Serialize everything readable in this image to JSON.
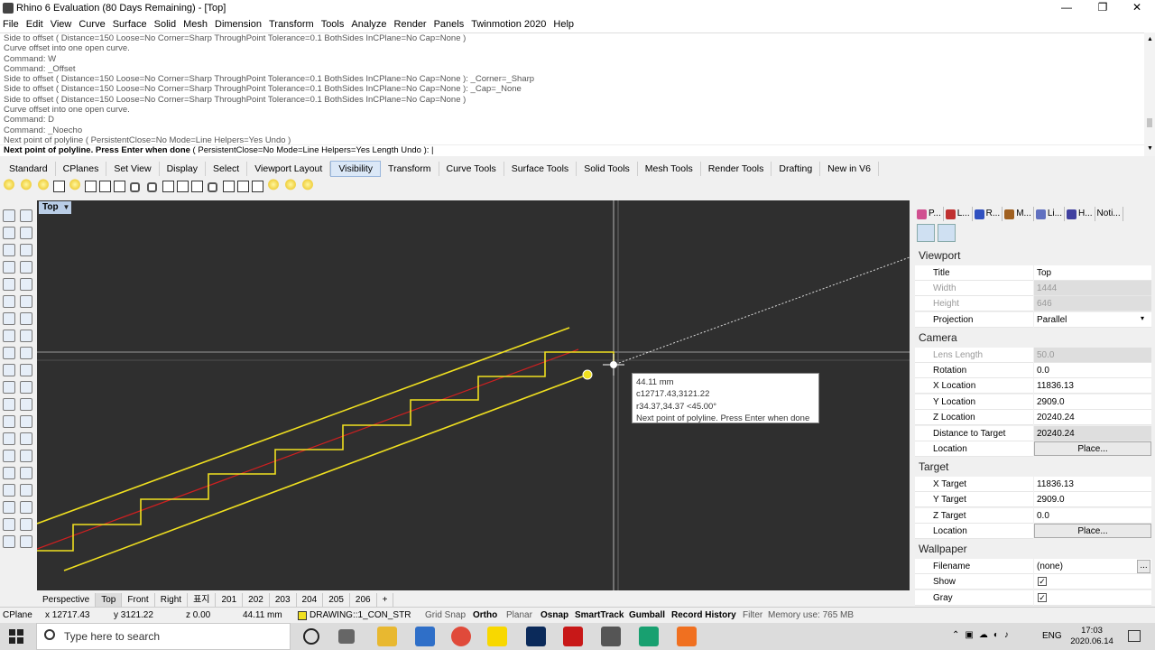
{
  "window": {
    "title": "Rhino 6 Evaluation (80 Days Remaining) - [Top]",
    "minimize": "—",
    "maximize": "❐",
    "close": "✕"
  },
  "menu": [
    "File",
    "Edit",
    "View",
    "Curve",
    "Surface",
    "Solid",
    "Mesh",
    "Dimension",
    "Transform",
    "Tools",
    "Analyze",
    "Render",
    "Panels",
    "Twinmotion 2020",
    "Help"
  ],
  "command_history": [
    "Side to offset ( Distance=150  Loose=No  Corner=Sharp  ThroughPoint  Tolerance=0.1  BothSides  InCPlane=No  Cap=None )",
    "Curve offset into one open curve.",
    "Command: W",
    "Command: _Offset",
    "Side to offset ( Distance=150  Loose=No  Corner=Sharp  ThroughPoint  Tolerance=0.1  BothSides  InCPlane=No  Cap=None ): _Corner=_Sharp",
    "Side to offset ( Distance=150  Loose=No  Corner=Sharp  ThroughPoint  Tolerance=0.1  BothSides  InCPlane=No  Cap=None ): _Cap=_None",
    "Side to offset ( Distance=150  Loose=No  Corner=Sharp  ThroughPoint  Tolerance=0.1  BothSides  InCPlane=No  Cap=None )",
    "Curve offset into one open curve.",
    "Command: D",
    "Command: _Noecho",
    "Next point of polyline ( PersistentClose=No  Mode=Line  Helpers=Yes  Undo )"
  ],
  "command_prompt": {
    "bold": "Next point of polyline. Press Enter when done",
    "rest": " ( PersistentClose=No  Mode=Line  Helpers=Yes  Length  Undo ): |"
  },
  "toolbar_tabs": [
    "Standard",
    "CPlanes",
    "Set View",
    "Display",
    "Select",
    "Viewport Layout",
    "Visibility",
    "Transform",
    "Curve Tools",
    "Surface Tools",
    "Solid Tools",
    "Mesh Tools",
    "Render Tools",
    "Drafting",
    "New in V6"
  ],
  "active_toolbar_tab": "Visibility",
  "viewport": {
    "name": "Top",
    "tooltip": {
      "distance": "44.11 mm",
      "coords": "c12717.43,3121.22",
      "polar": "r34.37,34.37     <45.00°",
      "message": "Next point of polyline. Press Enter when done"
    }
  },
  "panel_tabs": [
    "P...",
    "L...",
    "R...",
    "M...",
    "Li...",
    "H...",
    "Noti..."
  ],
  "properties": {
    "viewport_header": "Viewport",
    "viewport": [
      {
        "label": "Title",
        "value": "Top",
        "disabled": false
      },
      {
        "label": "Width",
        "value": "1444",
        "disabled": true
      },
      {
        "label": "Height",
        "value": "646",
        "disabled": true
      },
      {
        "label": "Projection",
        "value": "Parallel",
        "disabled": false
      }
    ],
    "camera_header": "Camera",
    "camera": [
      {
        "label": "Lens Length",
        "value": "50.0",
        "disabled": true
      },
      {
        "label": "Rotation",
        "value": "0.0",
        "disabled": false
      },
      {
        "label": "X Location",
        "value": "11836.13",
        "disabled": false
      },
      {
        "label": "Y Location",
        "value": "2909.0",
        "disabled": false
      },
      {
        "label": "Z Location",
        "value": "20240.24",
        "disabled": false
      },
      {
        "label": "Distance to Target",
        "value": "20240.24",
        "disabled": false
      }
    ],
    "camera_location_label": "Location",
    "place_button": "Place...",
    "target_header": "Target",
    "target": [
      {
        "label": "X Target",
        "value": "11836.13"
      },
      {
        "label": "Y Target",
        "value": "2909.0"
      },
      {
        "label": "Z Target",
        "value": "0.0"
      }
    ],
    "target_location_label": "Location",
    "wallpaper_header": "Wallpaper",
    "filename_label": "Filename",
    "filename_value": "(none)",
    "filename_browse": "...",
    "show_label": "Show",
    "gray_label": "Gray",
    "check": "✓"
  },
  "viewport_tabs": [
    "Perspective",
    "Top",
    "Front",
    "Right",
    "표지",
    "201",
    "202",
    "203",
    "204",
    "205",
    "206",
    "+"
  ],
  "active_viewport_tab": "Top",
  "status": {
    "cplane": "CPlane",
    "x": "x 12717.43",
    "y": "y 3121.22",
    "z": "z 0.00",
    "units": "44.11 mm",
    "layer": "DRAWING::1_CON_STR",
    "layer_color": "#f0e020",
    "grid_snap": "Grid Snap",
    "ortho": "Ortho",
    "planar": "Planar",
    "osnap": "Osnap",
    "smarttrack": "SmartTrack",
    "gumball": "Gumball",
    "record_history": "Record History",
    "filter": "Filter",
    "memory": "Memory use: 765 MB"
  },
  "taskbar": {
    "search_placeholder": "Type here to search",
    "lang": "ENG",
    "time": "17:03",
    "date": "2020.06.14"
  },
  "colors": {
    "viewport_bg": "#2f2f2f",
    "curve_yellow": "#f0e020",
    "centerline_red": "#d02020",
    "active_tab": "#dbe8f7"
  }
}
